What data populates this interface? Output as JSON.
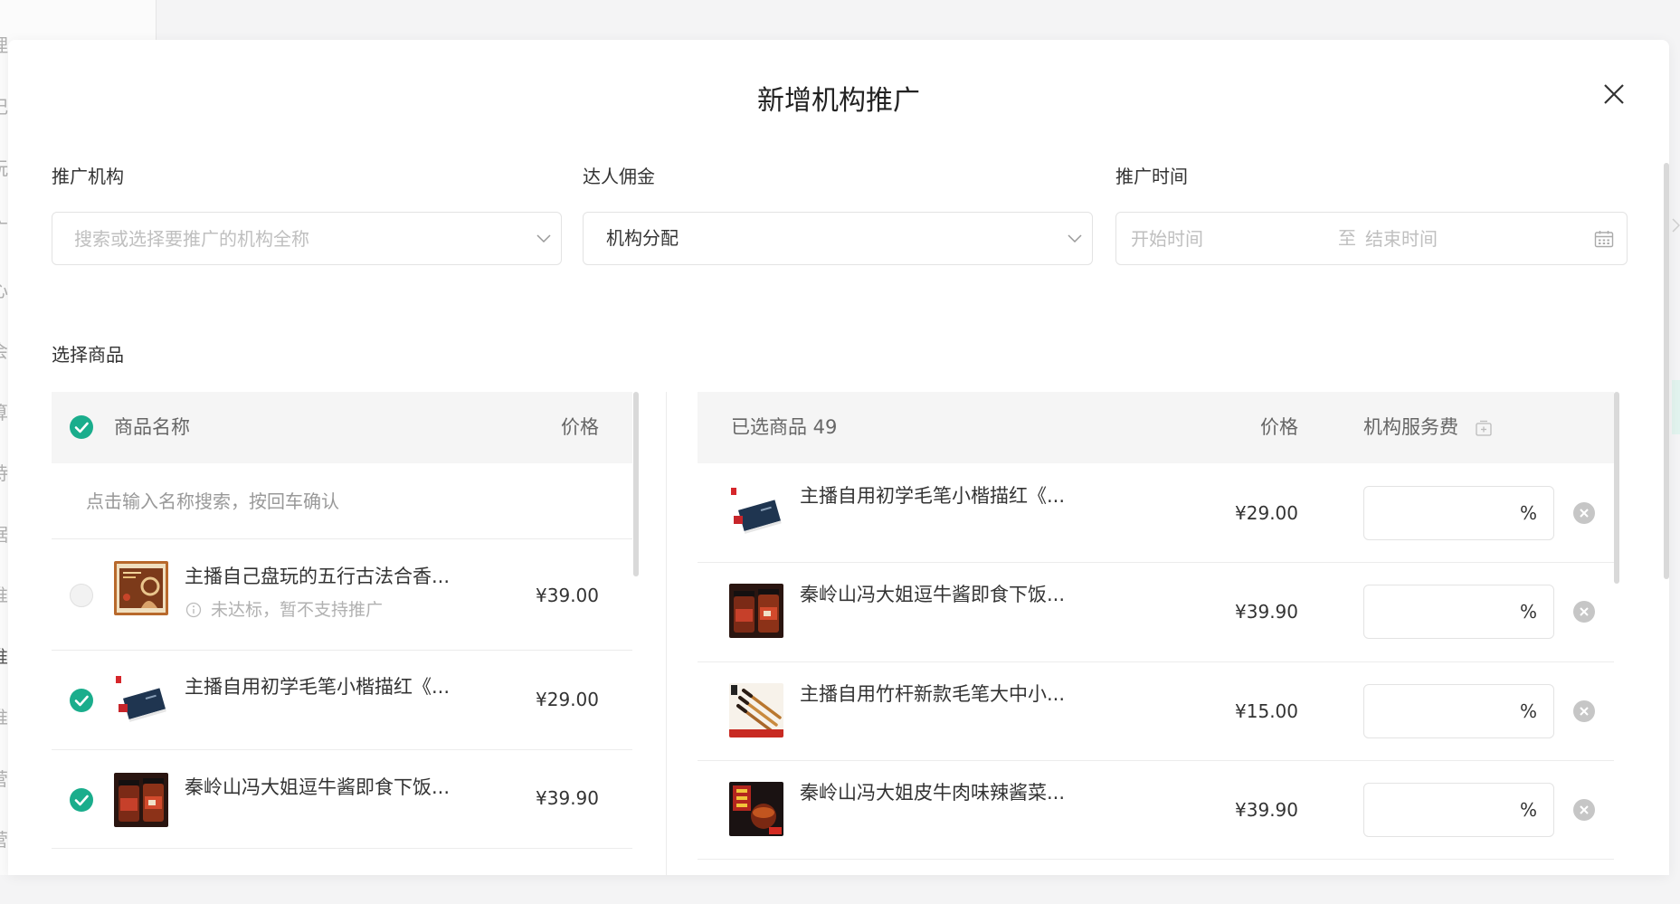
{
  "colors": {
    "accent": "#1aad8c",
    "border": "#e3e3e3",
    "header_bg": "#f5f5f5",
    "text": "#333333",
    "muted": "#999999"
  },
  "background": {
    "sidebar_fragments": [
      "理",
      "记",
      "玩",
      "广",
      "心",
      "会",
      "算",
      "持",
      "据",
      "推",
      "推",
      "推",
      "营",
      "营"
    ]
  },
  "modal": {
    "title": "新增机构推广"
  },
  "form": {
    "org": {
      "label": "推广机构",
      "placeholder": "搜索或选择要推广的机构全称"
    },
    "commission": {
      "label": "达人佣金",
      "value": "机构分配"
    },
    "time": {
      "label": "推广时间",
      "start_placeholder": "开始时间",
      "separator": "至",
      "end_placeholder": "结束时间"
    }
  },
  "products_section": {
    "label": "选择商品"
  },
  "left_table": {
    "select_all_checked": true,
    "header": {
      "name": "商品名称",
      "price": "价格"
    },
    "search": {
      "placeholder": "点击输入名称搜索，按回车确认"
    },
    "rows": [
      {
        "title": "主播自己盘玩的五行古法合香...",
        "note": "未达标，暂不支持推广",
        "price": "¥39.00",
        "checked": false
      },
      {
        "title": "主播自用初学毛笔小楷描红《...",
        "price": "¥29.00",
        "checked": true
      },
      {
        "title": "秦岭山冯大姐逗牛酱即食下饭...",
        "price": "¥39.90",
        "checked": true
      }
    ]
  },
  "right_table": {
    "header": {
      "selected": "已选商品 49",
      "price": "价格",
      "fee": "机构服务费"
    },
    "rows": [
      {
        "title": "主播自用初学毛笔小楷描红《...",
        "price": "¥29.00",
        "fee_unit": "%"
      },
      {
        "title": "秦岭山冯大姐逗牛酱即食下饭...",
        "price": "¥39.90",
        "fee_unit": "%"
      },
      {
        "title": "主播自用竹杆新款毛笔大中小...",
        "price": "¥15.00",
        "fee_unit": "%"
      },
      {
        "title": "秦岭山冯大姐皮牛肉味辣酱菜...",
        "price": "¥39.90",
        "fee_unit": "%"
      }
    ]
  }
}
